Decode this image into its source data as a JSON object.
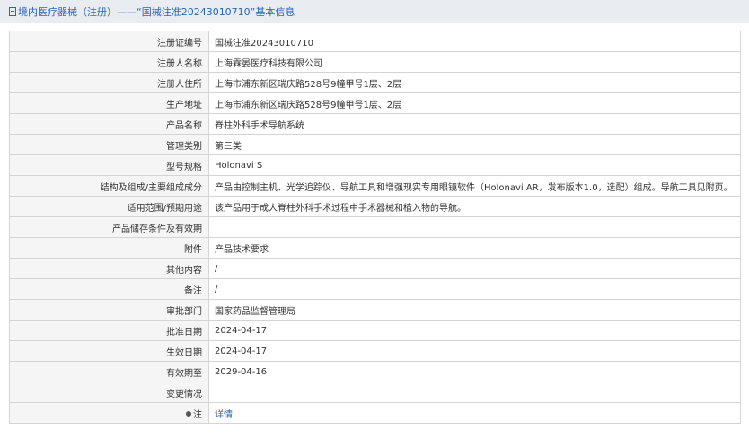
{
  "header": {
    "icon": "document-icon",
    "title": "境内医疗器械（注册）——“国械注准20243010710”基本信息"
  },
  "rows": [
    {
      "label": "注册证编号",
      "value": "国械注准20243010710"
    },
    {
      "label": "注册人名称",
      "value": "上海霖晏医疗科技有限公司"
    },
    {
      "label": "注册人住所",
      "value": "上海市浦东新区瑞庆路528号9幢甲号1层、2层"
    },
    {
      "label": "生产地址",
      "value": "上海市浦东新区瑞庆路528号9幢甲号1层、2层"
    },
    {
      "label": "产品名称",
      "value": "脊柱外科手术导航系统"
    },
    {
      "label": "管理类别",
      "value": "第三类"
    },
    {
      "label": "型号规格",
      "value": "Holonavi S"
    },
    {
      "label": "结构及组成/主要组成成分",
      "value": "产品由控制主机、光学追踪仪、导航工具和增强现实专用眼镜软件（Holonavi AR，发布版本1.0，选配）组成。导航工具见附页。"
    },
    {
      "label": "适用范围/预期用途",
      "value": "该产品用于成人脊柱外科手术过程中手术器械和植入物的导航。"
    },
    {
      "label": "产品储存条件及有效期",
      "value": ""
    },
    {
      "label": "附件",
      "value": "产品技术要求"
    },
    {
      "label": "其他内容",
      "value": "/"
    },
    {
      "label": "备注",
      "value": "/"
    },
    {
      "label": "审批部门",
      "value": "国家药品监督管理局"
    },
    {
      "label": "批准日期",
      "value": "2024-04-17"
    },
    {
      "label": "生效日期",
      "value": "2024-04-17"
    },
    {
      "label": "有效期至",
      "value": "2029-04-16"
    },
    {
      "label": "变更情况",
      "value": ""
    }
  ],
  "note_row": {
    "icon": "pin-icon",
    "label": "注",
    "link_text": "详情"
  }
}
